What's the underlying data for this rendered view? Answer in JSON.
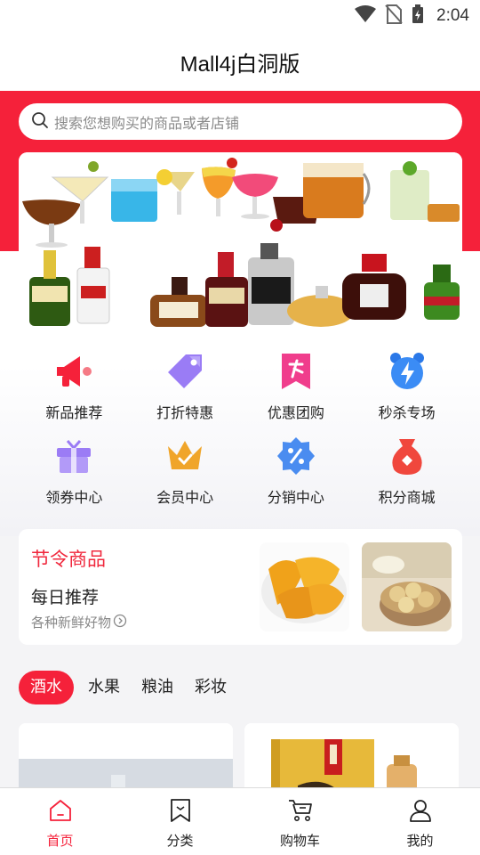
{
  "status_bar": {
    "time": "2:04",
    "icons": [
      "wifi-icon",
      "no-sim-icon",
      "battery-charging-icon"
    ]
  },
  "header": {
    "title": "Mall4j白洞版"
  },
  "search": {
    "placeholder": "搜索您想购买的商品或者店铺",
    "icon": "search-icon"
  },
  "banner": {
    "alt_icon": "drinks-banner-image"
  },
  "shortcuts": [
    {
      "label": "新品推荐",
      "icon": "megaphone-icon",
      "color": "#f5213a"
    },
    {
      "label": "打折特惠",
      "icon": "discount-tag-icon",
      "color": "#8a6cf4"
    },
    {
      "label": "优惠团购",
      "icon": "group-buy-bookmark-icon",
      "color": "#f03d8c"
    },
    {
      "label": "秒杀专场",
      "icon": "flash-alarm-clock-icon",
      "color": "#3b8cf5"
    },
    {
      "label": "领券中心",
      "icon": "gift-box-icon",
      "color": "#9b7cf5"
    },
    {
      "label": "会员中心",
      "icon": "crown-icon",
      "color": "#f0a52a"
    },
    {
      "label": "分销中心",
      "icon": "percent-badge-icon",
      "color": "#4a8cf0"
    },
    {
      "label": "积分商城",
      "icon": "money-bag-icon",
      "color": "#f0473d"
    }
  ],
  "seasonal": {
    "title": "节令商品",
    "subtitle": "每日推荐",
    "description": "各种新鲜好物",
    "images": [
      "dried-mango-image",
      "banana-chips-image"
    ]
  },
  "category_tabs": [
    {
      "label": "酒水",
      "active": true
    },
    {
      "label": "水果",
      "active": false
    },
    {
      "label": "粮油",
      "active": false
    },
    {
      "label": "彩妆",
      "active": false
    }
  ],
  "tab_bar": [
    {
      "label": "首页",
      "icon": "home-icon",
      "active": true
    },
    {
      "label": "分类",
      "icon": "category-bookmark-icon",
      "active": false
    },
    {
      "label": "购物车",
      "icon": "cart-icon",
      "active": false
    },
    {
      "label": "我的",
      "icon": "user-icon",
      "active": false
    }
  ],
  "colors": {
    "accent": "#f5213a",
    "background": "#f4f4f6"
  }
}
